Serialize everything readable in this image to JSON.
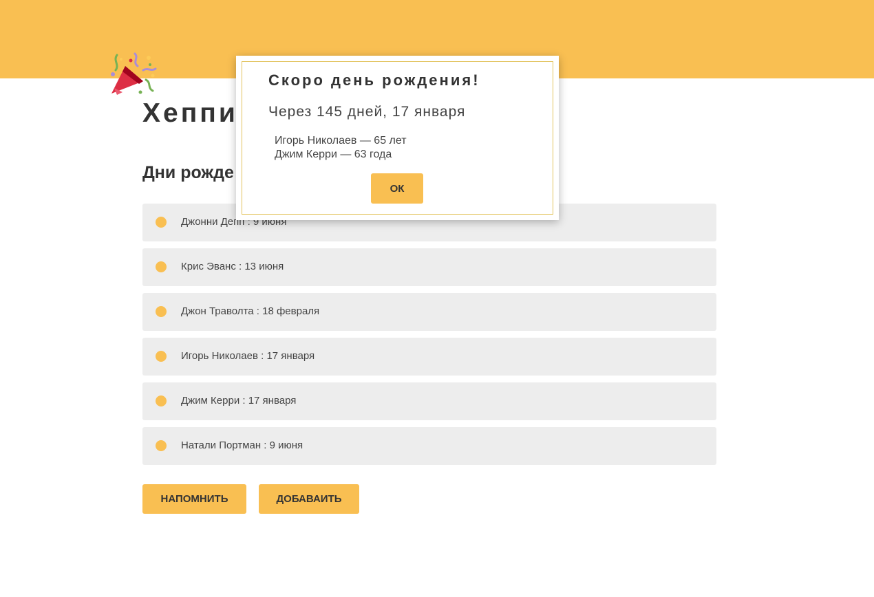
{
  "header": {
    "title": "Хеппи",
    "icon": "party-popper-icon",
    "band_color": "#f9bf52"
  },
  "main": {
    "section_title": "Дни рожде",
    "birthdays": [
      {
        "text": "Джонни Депп : 9 июня"
      },
      {
        "text": "Крис Эванс : 13 июня"
      },
      {
        "text": "Джон Траволта : 18 февраля"
      },
      {
        "text": "Игорь Николаев : 17 января"
      },
      {
        "text": "Джим Керри : 17 января"
      },
      {
        "text": "Натали Портман : 9 июня"
      }
    ],
    "remind_label": "НАПОМНИТЬ",
    "add_label": "ДОБАВАИТЬ"
  },
  "modal": {
    "title": "Скоро день рождения!",
    "subtitle": "Через 145 дней, 17 января",
    "people": [
      "Игорь Николаев — 65 лет",
      "Джим Керри — 63 года"
    ],
    "ok_label": "ОК"
  },
  "colors": {
    "accent": "#f9bf52",
    "item_background": "#ededed",
    "modal_border": "#e2c25a"
  }
}
